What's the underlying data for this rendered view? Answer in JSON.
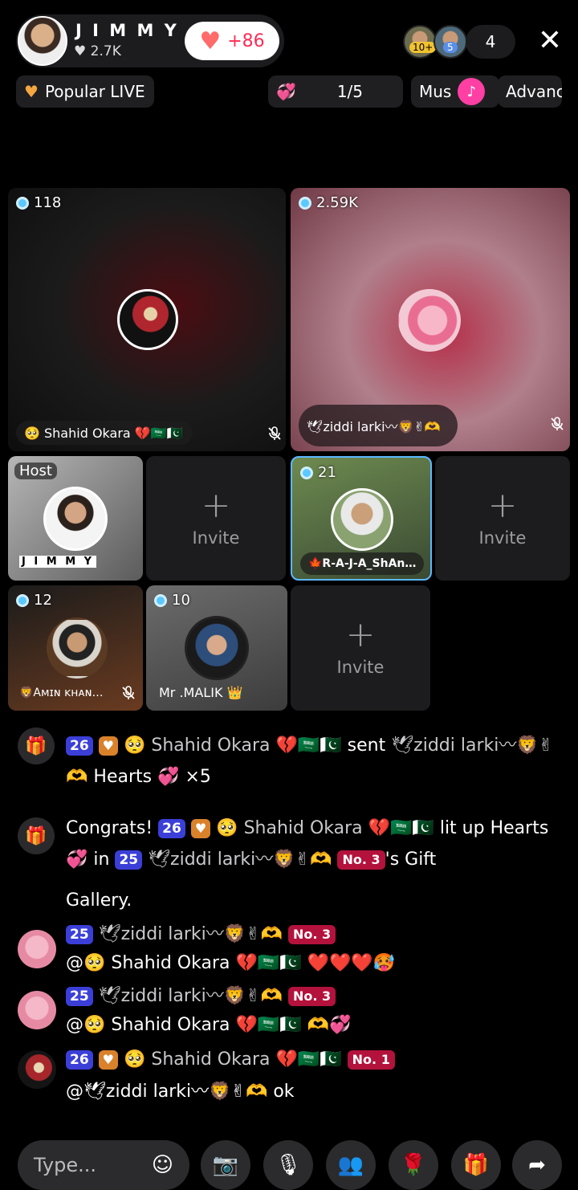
{
  "header": {
    "host_name": "J I M M Y",
    "likes": "2.7K",
    "like_button": "+86",
    "viewer_badges": [
      "10+",
      "5"
    ],
    "viewer_count": "4",
    "close_symbol": "✕"
  },
  "subheader": {
    "popular_live": "Popular LIVE",
    "page_indicator": "1/5",
    "music_label": "Mus",
    "advanced_label": "Advanc"
  },
  "grid": {
    "tile1": {
      "count": "118",
      "name": "🥺 Shahid Okara 💔🇸🇦🇵🇰"
    },
    "tile2": {
      "count": "2.59K",
      "name": "🕊ziddi larki〰🦁✌🫶"
    },
    "host_tile": {
      "label": "Host",
      "name": "J I M M Y"
    },
    "invite1": "Invite",
    "tile_raja": {
      "count": "21",
      "name": "🍁R-A-J-A_ShAn…"
    },
    "invite2": "Invite",
    "tile_amin": {
      "count": "12",
      "name": "🦁Aᴍɪɴ ᴋʜᴀɴ…"
    },
    "tile_malik": {
      "count": "10",
      "name": "Mr .MALIK 👑"
    },
    "invite3": "Invite"
  },
  "chat": {
    "m1": {
      "badge": "26",
      "user": "🥺 Shahid Okara 💔🇸🇦🇵🇰",
      "action": "sent",
      "target": "🕊ziddi larki〰🦁✌🫶",
      "gift": "Hearts 💞 ×5"
    },
    "m2": {
      "lead": "Congrats!",
      "badge1": "26",
      "user": "🥺 Shahid Okara 💔🇸🇦🇵🇰",
      "mid": "lit up",
      "gift": "Hearts 💞 in",
      "badge2": "25",
      "target": "🕊ziddi larki〰🦁✌🫶",
      "rank": "No. 3",
      "tail": "'s Gift",
      "last": "Gallery."
    },
    "m3": {
      "badge": "25",
      "user": "🕊ziddi larki〰🦁✌🫶",
      "rank": "No. 3",
      "text": "@🥺 Shahid Okara 💔🇸🇦🇵🇰 ❤️❤️❤️🥵"
    },
    "m4": {
      "badge": "25",
      "user": "🕊ziddi larki〰🦁✌🫶",
      "rank": "No. 3",
      "text": "@🥺 Shahid Okara 💔🇸🇦🇵🇰 🫶💞"
    },
    "m5": {
      "badge": "26",
      "user": "🥺 Shahid Okara 💔🇸🇦🇵🇰",
      "rank": "No. 1",
      "text": "@🕊ziddi larki〰🦁✌🫶 ok"
    }
  },
  "composer": {
    "placeholder": "Type..."
  },
  "icons": [
    "gift-icon",
    "mute-mic-icon",
    "camera-off-icon",
    "mic-off-icon",
    "people-icon",
    "rose-icon",
    "share-icon",
    "emoji-icon",
    "close-icon",
    "plus-icon"
  ],
  "colors": {
    "accent": "#fe2c55",
    "diamond_badge": "#3b3fd8",
    "rank_badge": "#b3123c",
    "selected_border": "#5bb8ff"
  }
}
